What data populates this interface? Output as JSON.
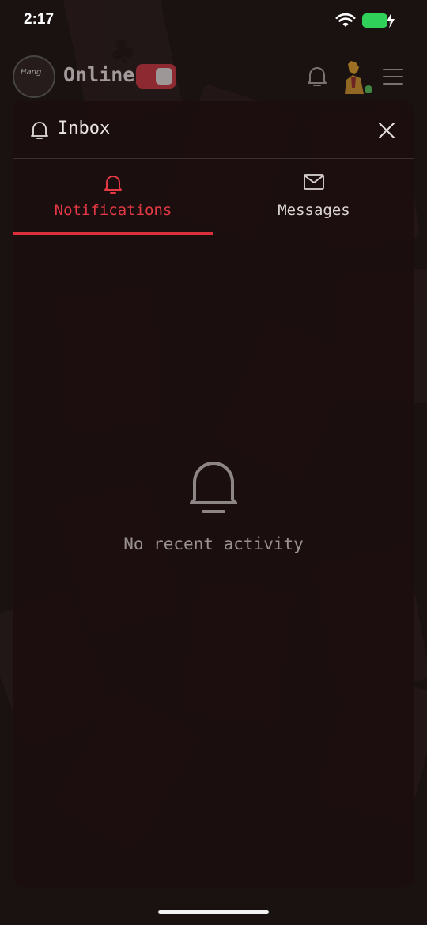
{
  "status_bar": {
    "time": "2:17"
  },
  "header": {
    "logo_text": "Hang",
    "online_label": "Online"
  },
  "inbox": {
    "title": "Inbox",
    "tabs": [
      {
        "label": "Notifications",
        "active": true
      },
      {
        "label": "Messages",
        "active": false
      }
    ],
    "empty_state": "No recent activity"
  },
  "colors": {
    "accent": "#d9303c",
    "battery": "#30d158",
    "presence": "#4caf50"
  },
  "icons": [
    "wifi-icon",
    "battery-icon",
    "bell-icon",
    "menu-icon",
    "close-icon",
    "mail-icon"
  ]
}
